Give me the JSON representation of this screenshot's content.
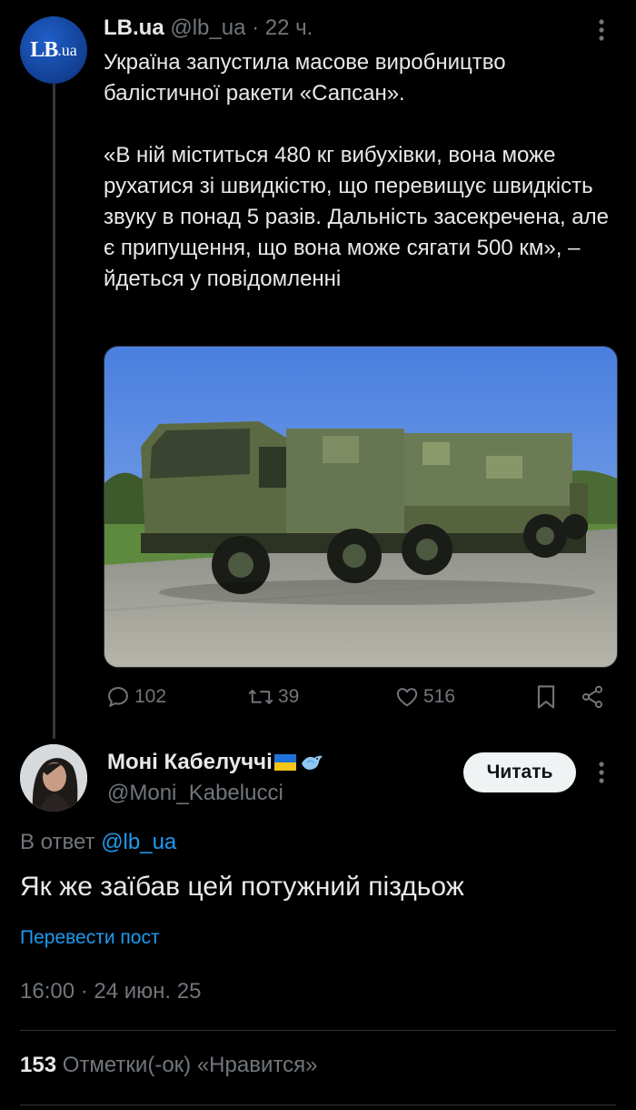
{
  "parent_post": {
    "author_name": "LB.ua",
    "handle": "@lb_ua",
    "separator": "·",
    "time_ago": "22 ч.",
    "avatar": {
      "logo_main": "LB",
      "logo_suffix": ".ua"
    },
    "text": "Україна запустила масове виробництво балістичної ракети «Сапсан».\n\n«В ній міститься 480 кг вибухівки, вона може рухатися зі швидкістю, що перевищує швидкість звуку в понад 5 разів. Дальність засекречена, але є припущення, що вона може сягати 500 км», – йдеться у повідомленні",
    "media": {
      "description_icon": "military-truck-photo"
    },
    "actions": {
      "replies": "102",
      "reposts": "39",
      "likes": "516"
    }
  },
  "reply": {
    "author_name": "Моні Кабелуччі",
    "handle": "@Moni_Kabelucci",
    "follow_label": "Читать",
    "reply_to_prefix": "В ответ",
    "reply_to_handle": "@lb_ua",
    "text": "Як же заїбав цей потужний піздьож",
    "translate_label": "Перевести пост",
    "timestamp": "16:00 · 24 июн. 25",
    "likes_count": "153",
    "likes_label": "Отметки(-ок) «Нравится»"
  },
  "colors": {
    "background": "#000000",
    "text_primary": "#e7e9ea",
    "text_secondary": "#71767b",
    "accent": "#1d9bf0",
    "divider": "#2f3336"
  }
}
